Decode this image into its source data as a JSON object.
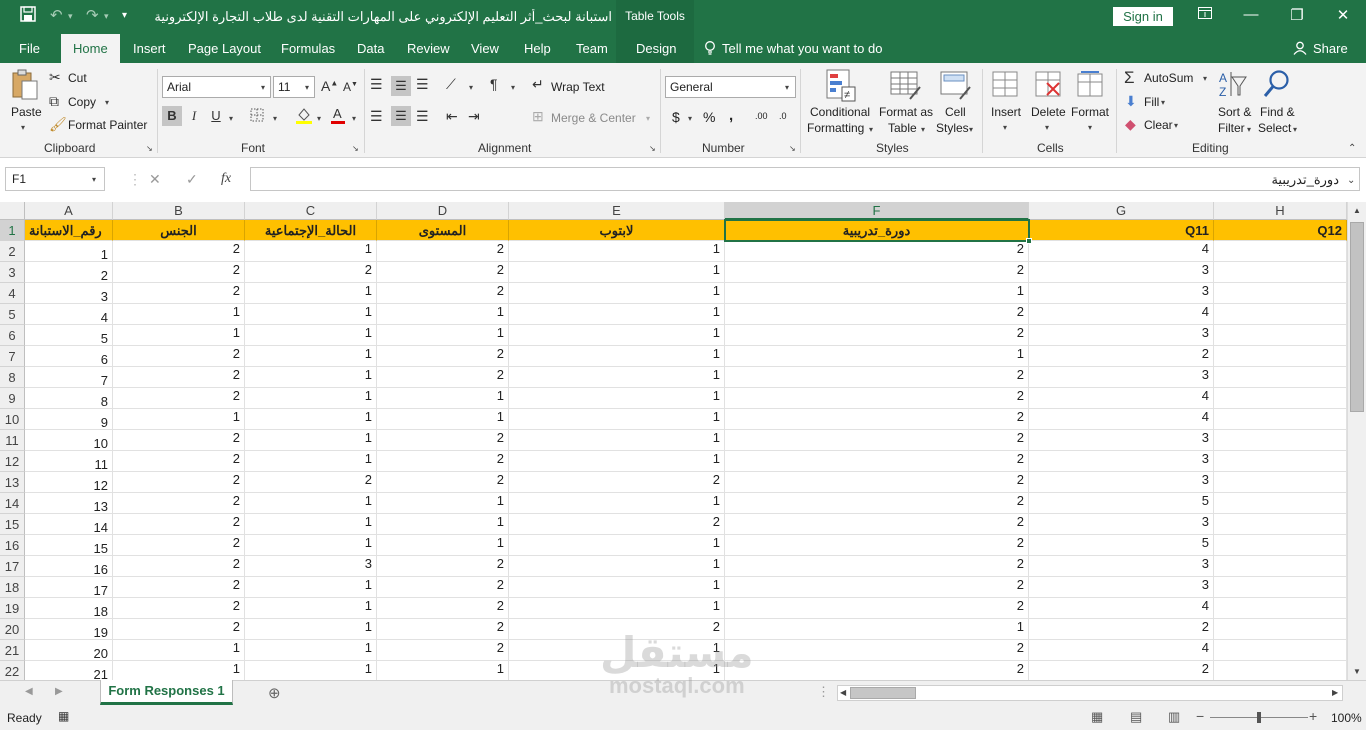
{
  "titlebar": {
    "document_title": "استبانة لبحث_أثر التعليم الإلكتروني على المهارات التقنية لدى طلاب التجارة الإلكترونية في كلي...",
    "context_tab": "Table Tools",
    "sign_in": "Sign in",
    "save_icon": "save-icon",
    "undo_icon": "undo-icon",
    "redo_icon": "redo-icon",
    "window_controls": [
      "ribbon-display-icon",
      "minimize-icon",
      "restore-icon",
      "close-icon"
    ]
  },
  "ribbon_tabs": [
    "File",
    "Home",
    "Insert",
    "Page Layout",
    "Formulas",
    "Data",
    "Review",
    "View",
    "Help",
    "Team",
    "Design"
  ],
  "tell_me": "Tell me what you want to do",
  "share": "Share",
  "clipboard": {
    "paste": "Paste",
    "cut": "Cut",
    "copy": "Copy",
    "format_painter": "Format Painter",
    "label": "Clipboard"
  },
  "font": {
    "family": "Arial",
    "size": "11",
    "label": "Font",
    "bold": "B",
    "italic": "I",
    "underline": "U"
  },
  "alignment": {
    "wrap_text": "Wrap Text",
    "merge_center": "Merge & Center",
    "label": "Alignment"
  },
  "number": {
    "format": "General",
    "currency": "$",
    "percent": "%",
    "comma": ",",
    "inc_decimal": ".00",
    "dec_decimal": ".0",
    "label": "Number"
  },
  "styles": {
    "conditional": [
      "Conditional",
      "Formatting"
    ],
    "format_table": [
      "Format as",
      "Table"
    ],
    "cell_styles": [
      "Cell",
      "Styles"
    ],
    "label": "Styles"
  },
  "cells": {
    "insert": "Insert",
    "delete": "Delete",
    "format": "Format",
    "label": "Cells"
  },
  "editing": {
    "autosum": "AutoSum",
    "fill": "Fill",
    "clear": "Clear",
    "sort_filter": [
      "Sort &",
      "Filter"
    ],
    "find_select": [
      "Find &",
      "Select"
    ],
    "label": "Editing"
  },
  "formula_bar": {
    "name_box": "F1",
    "cancel": "✕",
    "enter": "✓",
    "fx": "fx",
    "content": "دورة_تدريبية"
  },
  "sheet": {
    "columns": [
      "A",
      "B",
      "C",
      "D",
      "E",
      "F",
      "G",
      "H"
    ],
    "headers": [
      "رقم_الاستبانة",
      "الجنس",
      "الحالة_الإجتماعية",
      "المستوى",
      "لابتوب",
      "دورة_تدريبية",
      "Q11",
      "Q12"
    ],
    "row_numbers": [
      "1",
      "2",
      "3",
      "4",
      "5",
      "6",
      "7",
      "8",
      "9",
      "10",
      "11",
      "12",
      "13",
      "14",
      "15",
      "16",
      "17",
      "18",
      "19",
      "20",
      "21",
      "22"
    ],
    "rows": [
      [
        "1",
        "2",
        "1",
        "2",
        "1",
        "2",
        "4"
      ],
      [
        "2",
        "2",
        "2",
        "2",
        "1",
        "2",
        "3"
      ],
      [
        "3",
        "2",
        "1",
        "2",
        "1",
        "1",
        "3"
      ],
      [
        "4",
        "1",
        "1",
        "1",
        "1",
        "2",
        "4"
      ],
      [
        "5",
        "1",
        "1",
        "1",
        "1",
        "2",
        "3"
      ],
      [
        "6",
        "2",
        "1",
        "2",
        "1",
        "1",
        "2"
      ],
      [
        "7",
        "2",
        "1",
        "2",
        "1",
        "2",
        "3"
      ],
      [
        "8",
        "2",
        "1",
        "1",
        "1",
        "2",
        "4"
      ],
      [
        "9",
        "1",
        "1",
        "1",
        "1",
        "2",
        "4"
      ],
      [
        "10",
        "2",
        "1",
        "2",
        "1",
        "2",
        "3"
      ],
      [
        "11",
        "2",
        "1",
        "2",
        "1",
        "2",
        "3"
      ],
      [
        "12",
        "2",
        "2",
        "2",
        "2",
        "2",
        "3"
      ],
      [
        "13",
        "2",
        "1",
        "1",
        "1",
        "2",
        "5"
      ],
      [
        "14",
        "2",
        "1",
        "1",
        "2",
        "2",
        "3"
      ],
      [
        "15",
        "2",
        "1",
        "1",
        "1",
        "2",
        "5"
      ],
      [
        "16",
        "2",
        "3",
        "2",
        "1",
        "2",
        "3"
      ],
      [
        "17",
        "2",
        "1",
        "2",
        "1",
        "2",
        "3"
      ],
      [
        "18",
        "2",
        "1",
        "2",
        "1",
        "2",
        "4"
      ],
      [
        "19",
        "2",
        "1",
        "2",
        "2",
        "1",
        "2"
      ],
      [
        "20",
        "1",
        "1",
        "2",
        "1",
        "2",
        "4"
      ],
      [
        "21",
        "1",
        "1",
        "1",
        "1",
        "2",
        "2"
      ]
    ],
    "active_cell": "F1"
  },
  "sheet_tabs": [
    "Form Responses 1"
  ],
  "status": {
    "ready": "Ready",
    "zoom": "100%"
  },
  "watermark": {
    "arabic": "مستقل",
    "latin": "mostaql.com"
  }
}
